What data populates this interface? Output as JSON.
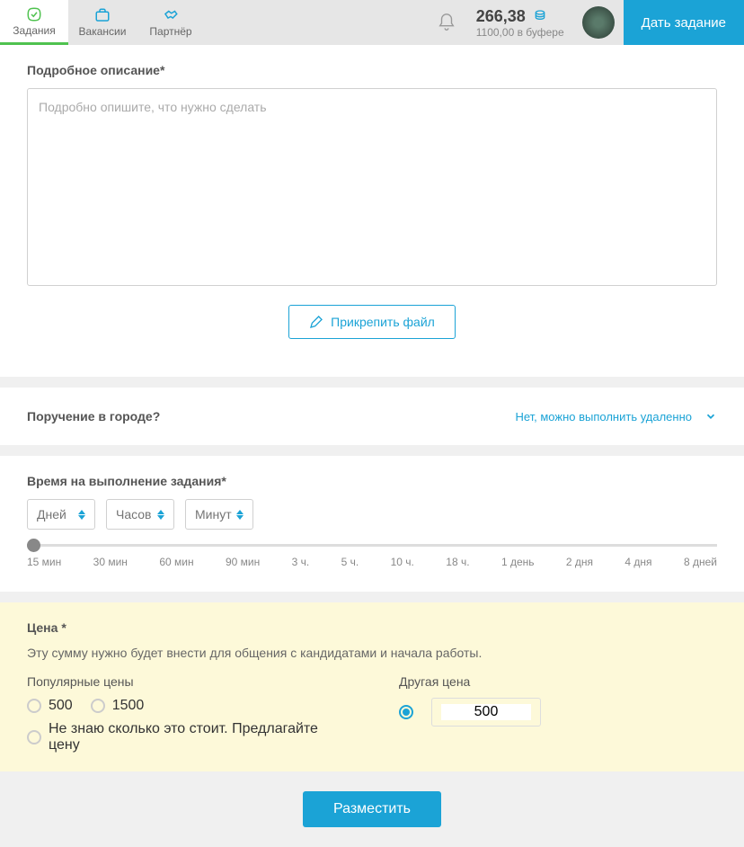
{
  "header": {
    "tabs": [
      {
        "label": "Задания"
      },
      {
        "label": "Вакансии"
      },
      {
        "label": "Партнёр"
      }
    ],
    "balance_main": "266,38",
    "balance_buffer": "1100,00 в буфере",
    "give_task_label": "Дать задание"
  },
  "description": {
    "title": "Подробное описание*",
    "placeholder": "Подробно опишите, что нужно сделать",
    "value": ""
  },
  "attach": {
    "label": "Прикрепить файл"
  },
  "city": {
    "question": "Поручение в городе?",
    "answer": "Нет, можно выполнить удаленно"
  },
  "time": {
    "title": "Время на выполнение задания*",
    "inputs": {
      "days": "Дней",
      "hours": "Часов",
      "minutes": "Минут"
    },
    "slider_labels": [
      "15 мин",
      "30 мин",
      "60 мин",
      "90 мин",
      "3 ч.",
      "5 ч.",
      "10 ч.",
      "18 ч.",
      "1 день",
      "2 дня",
      "4 дня",
      "8 дней"
    ]
  },
  "price": {
    "title": "Цена *",
    "note": "Эту сумму нужно будет внести для общения с кандидатами и начала работы.",
    "popular_title": "Популярные цены",
    "popular_options": [
      "500",
      "1500"
    ],
    "unknown_label": "Не знаю сколько это стоит. Предлагайте цену",
    "other_title": "Другая цена",
    "other_value": "500"
  },
  "submit": {
    "label": "Разместить"
  }
}
